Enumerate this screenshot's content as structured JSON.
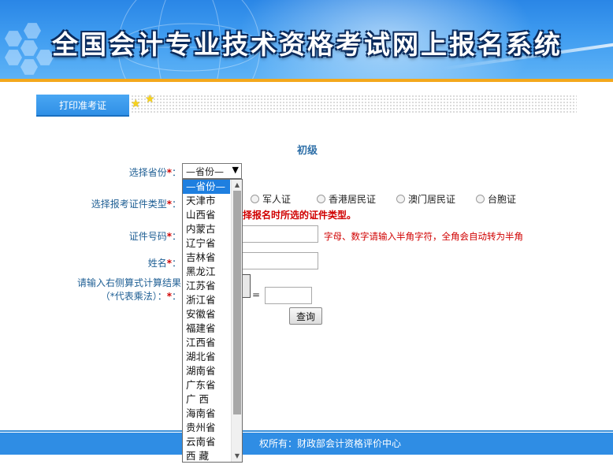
{
  "header": {
    "title": "全国会计专业技术资格考试网上报名系统"
  },
  "tabbar": {
    "print_tab_label": "打印准考证"
  },
  "form": {
    "level": "初级",
    "province_label": "选择省份",
    "province_selected": "—省份—",
    "id_type_label": "选择报考证件类型",
    "id_type_options": [
      "军人证",
      "香港居民证",
      "澳门居民证",
      "台胞证"
    ],
    "id_type_warning": "择报名时所选的证件类型。",
    "id_number_label": "证件号码",
    "id_number_hint": "字母、数字请输入半角字符，全角会自动转为半角",
    "name_label": "姓名",
    "captcha_label_line1": "请输入右侧算式计算结果",
    "captcha_label_line2": "（*代表乘法）：",
    "required_mark": "*",
    "colon": "：",
    "equals": "=",
    "query_button": "查询"
  },
  "dropdown": {
    "options": [
      "—省份—",
      "天津市",
      "山西省",
      "内蒙古",
      "辽宁省",
      "吉林省",
      "黑龙江",
      "江苏省",
      "浙江省",
      "安徽省",
      "福建省",
      "江西省",
      "湖北省",
      "湖南省",
      "广东省",
      "广  西",
      "海南省",
      "贵州省",
      "云南省",
      "西  藏"
    ],
    "selected_index": 0
  },
  "footer": {
    "text": "权所有：财政部会计资格评价中心"
  },
  "colors": {
    "banner_blue": "#2a86e6",
    "accent_orange": "#f3a81c",
    "label_blue": "#1f5f94",
    "required_red": "#d00000",
    "selected_blue": "#1e7fe0"
  }
}
